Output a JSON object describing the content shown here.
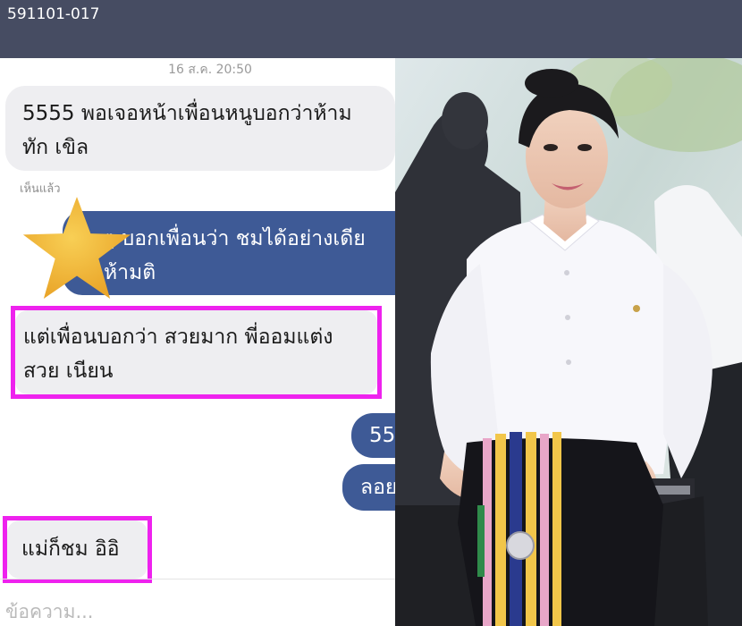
{
  "header": {
    "id_text": "591101-017"
  },
  "chat": {
    "timestamp": "16 ส.ค. 20:50",
    "messages": [
      {
        "side": "in",
        "lines": [
          "5555 พอเจอหน้าเพื่อนหนูบอกว่าห้าม",
          "ทัก เขิล"
        ]
      },
      {
        "side": "out",
        "lines": [
          "ๆ บอกเพื่อนว่า ชมได้อย่างเดีย",
          "ห้ามติ"
        ]
      },
      {
        "side": "in",
        "lines": [
          "แต่เพื่อนบอกว่า สวยมาก พี่ออมแต่ง",
          "สวย เนียน"
        ],
        "highlighted": true
      },
      {
        "side": "out",
        "lines": [
          "55"
        ]
      },
      {
        "side": "out",
        "lines": [
          "ลอย"
        ]
      },
      {
        "side": "in",
        "lines": [
          "แม่ก็ชม อิอิ"
        ],
        "highlighted": true
      }
    ],
    "seen_label": "เห็นแล้ว",
    "input_placeholder": "ข้อความ..."
  },
  "colors": {
    "topbar": "#464c62",
    "incoming_bubble": "#eeeef1",
    "outgoing_bubble": "#3e5a96",
    "highlight_border": "#ee22ee",
    "star": "#f2b83a"
  }
}
